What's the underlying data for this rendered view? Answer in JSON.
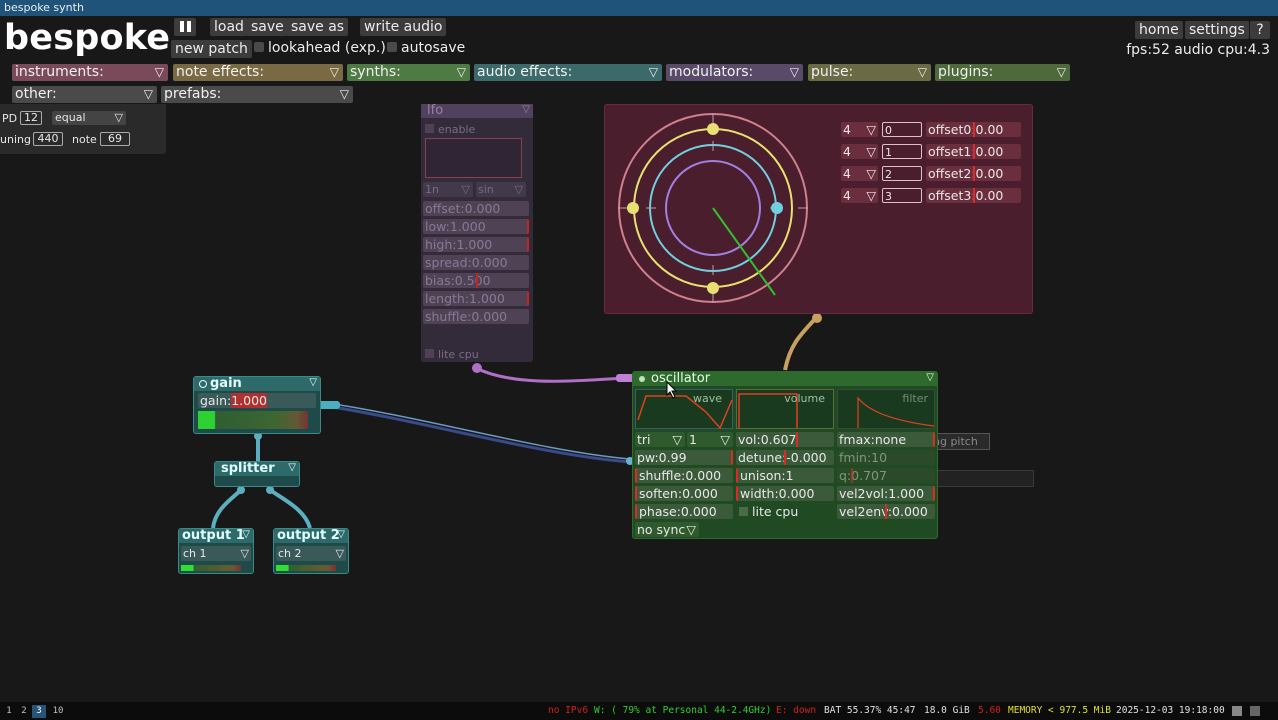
{
  "window_title": "bespoke synth",
  "app": {
    "logo": "bespoke",
    "pause_icon": "pause-icon",
    "load": "load",
    "save": "save",
    "save_as": "save as",
    "write_audio": "write audio",
    "new_patch": "new patch",
    "lookahead": "lookahead (exp.)",
    "autosave": "autosave",
    "home": "home",
    "settings": "settings",
    "help": "?",
    "fps": "fps:52  audio cpu:4.3"
  },
  "categories": {
    "instruments": "instruments:",
    "note_effects": "note effects:",
    "synths": "synths:",
    "audio_effects": "audio effects:",
    "modulators": "modulators:",
    "pulse": "pulse:",
    "plugins": "plugins:",
    "other": "other:",
    "prefabs": "prefabs:"
  },
  "scale_panel": {
    "pd_label": "PD",
    "pd_value": "12",
    "mode": "equal",
    "tuning_label": "uning",
    "tuning_value": "440",
    "note_label": "note",
    "note_value": "69"
  },
  "lfo": {
    "title": "lfo",
    "enable": "enable",
    "interval": "1n",
    "shape": "sin",
    "offset": "offset:0.000",
    "low": "low:1.000",
    "high": "high:1.000",
    "spread": "spread:0.000",
    "bias": "bias:0.500",
    "length": "length:1.000",
    "shuffle": "shuffle:0.000",
    "lite_cpu": "lite cpu"
  },
  "polyrhythm": {
    "rows": [
      {
        "steps": "4",
        "num": "0",
        "offset": "offset0:0.00"
      },
      {
        "steps": "4",
        "num": "1",
        "offset": "offset1:0.00"
      },
      {
        "steps": "4",
        "num": "2",
        "offset": "offset2:0.00"
      },
      {
        "steps": "4",
        "num": "3",
        "offset": "offset3:0.00"
      }
    ]
  },
  "gain": {
    "title": "gain",
    "label": "gain:",
    "value": "1.000"
  },
  "splitter": {
    "title": "splitter"
  },
  "output1": {
    "title": "output 1",
    "ch_label": "ch",
    "ch_value": "1"
  },
  "output2": {
    "title": "output 2",
    "ch_label": "ch",
    "ch_value": "2"
  },
  "oscillator": {
    "title": "oscillator",
    "tab_wave": "wave",
    "tab_volume": "volume",
    "tab_filter": "filter",
    "wave": "tri",
    "mult": "1",
    "pw": "pw:0.99",
    "shuffle": "shuffle:0.000",
    "soften": "soften:0.000",
    "phase": "phase:0.000",
    "sync": "no sync",
    "vol": "vol:0.607",
    "detune": "detune:-0.000",
    "unison": "unison:1",
    "width": "width:0.000",
    "lite_cpu": "lite cpu",
    "fmax": "fmax:none",
    "fmin": "fmin:10",
    "q": "q:0.707",
    "vel2vol": "vel2vol:1.000",
    "vel2env": "vel2env:0.000"
  },
  "ghost": {
    "pitch": "ng pitch"
  },
  "statusbar": {
    "workspaces": [
      "1",
      "2",
      "3",
      "10"
    ],
    "active_workspace": "3",
    "net_down": "no IPv6",
    "wifi": "W: ( 79% at Personal 44-2.4GHz)",
    "eth": "E: down",
    "battery": "BAT 55.37% 45:47",
    "disk": "18.0 GiB",
    "load": "5.60",
    "memory": "MEMORY < 977.5 MiB",
    "datetime": "2025-12-03 19:18:00"
  },
  "colors": {
    "lfo": "#6a4a7a",
    "oscillator": "#2d6a2d",
    "gain": "#3a8a8a",
    "polyrhythm": "#6a2a3a"
  }
}
